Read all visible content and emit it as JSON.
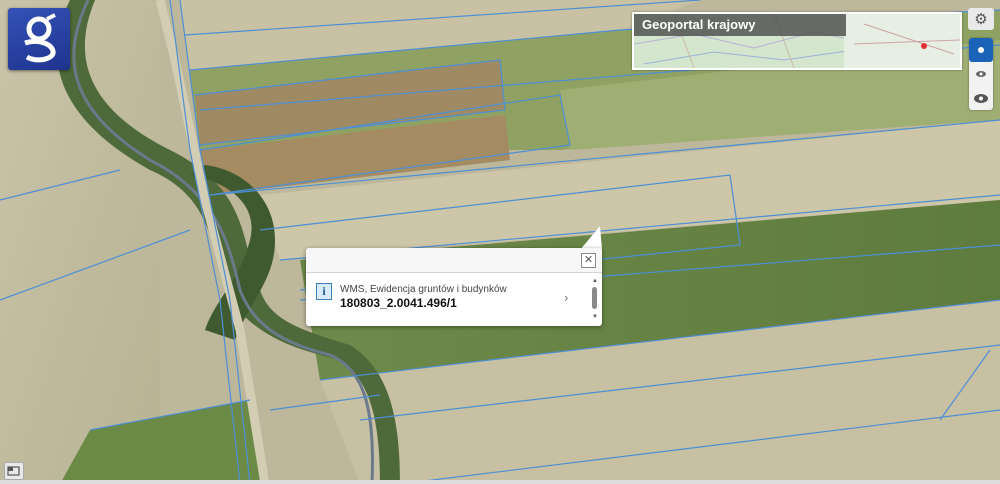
{
  "overview_map": {
    "title": "Geoportal krajowy",
    "highlight_color": "#e03030"
  },
  "popup": {
    "layer_name": "WMS, Ewidencja gruntów i budynków",
    "parcel_id": "180803_2.0041.496/1",
    "close_symbol": "✕",
    "info_symbol": "i",
    "next_symbol": "›"
  },
  "icons": {
    "logo": "geoportal-g-logo",
    "settings": "gear-icon",
    "zoom_levels": [
      "dot-icon-active",
      "eye-small-icon",
      "eye-large-icon"
    ],
    "corner": "window-icon"
  },
  "colors": {
    "parcel_line": "#4d8fd6",
    "accent": "#1b63b8",
    "logo_bg": "#2a45a6"
  }
}
